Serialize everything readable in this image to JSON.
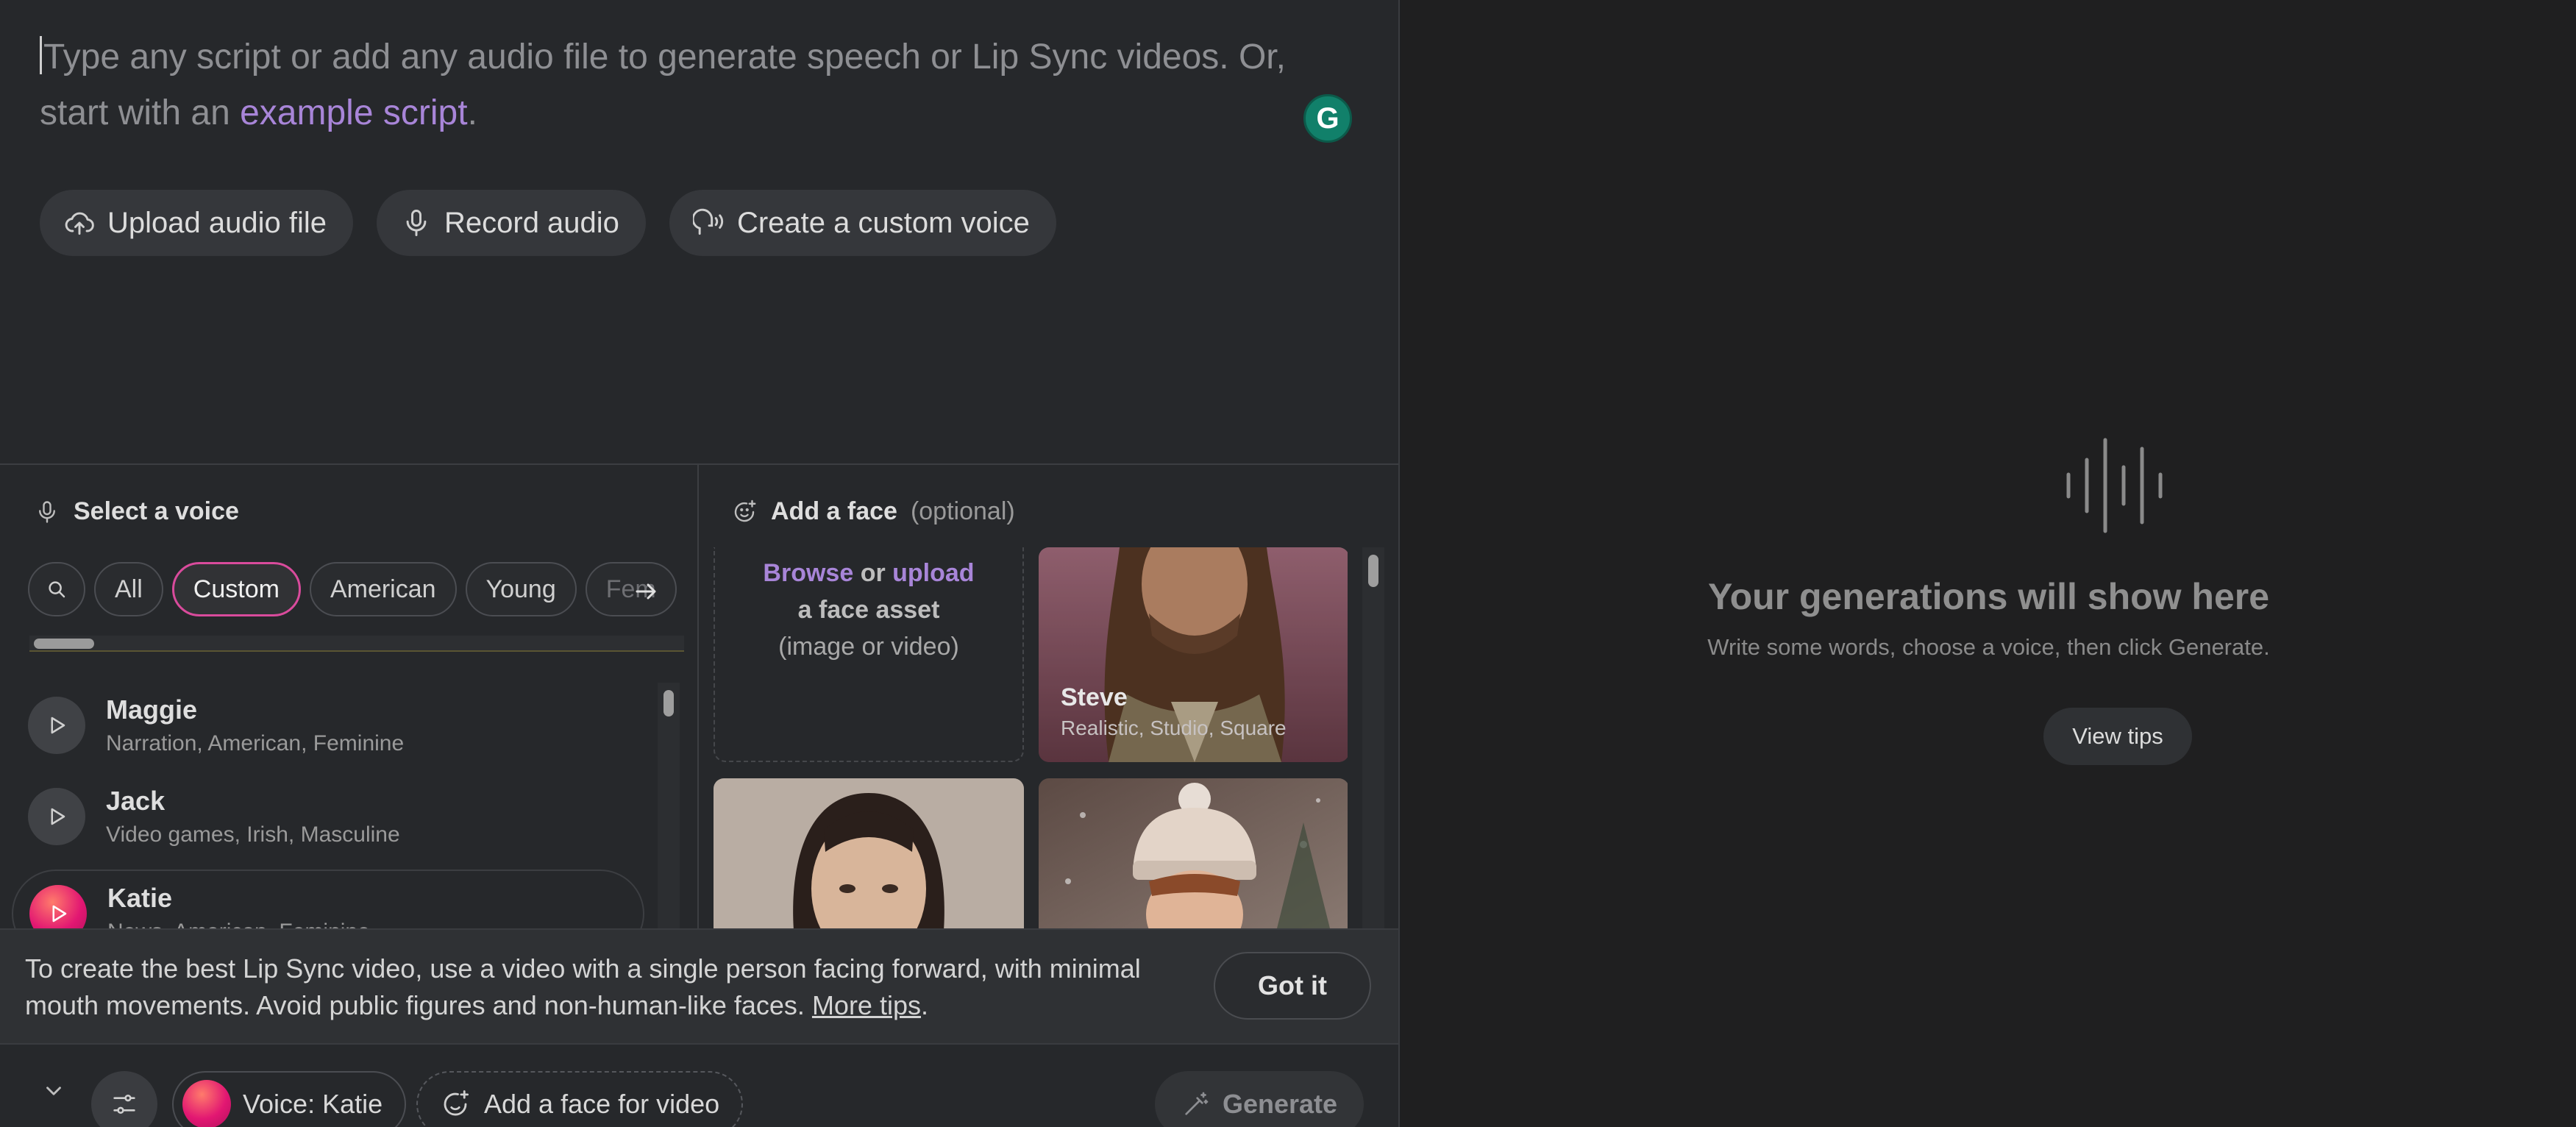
{
  "script": {
    "placeholder_before": "Type any script or add any audio file to generate speech or Lip Sync videos. Or, start with an ",
    "example_link": "example script",
    "placeholder_after": ".",
    "grammarly_letter": "G"
  },
  "actions": {
    "upload": "Upload audio file",
    "record": "Record audio",
    "custom_voice": "Create a custom voice"
  },
  "voice_panel": {
    "title": "Select a voice",
    "filters": [
      "All",
      "Custom",
      "American",
      "Young",
      "Fem"
    ],
    "active_filter": "Custom",
    "voices": [
      {
        "name": "Maggie",
        "tags": "Narration, American, Feminine"
      },
      {
        "name": "Jack",
        "tags": "Video games, Irish, Masculine"
      },
      {
        "name": "Katie",
        "tags": "News, American, Feminine"
      }
    ]
  },
  "face_panel": {
    "title": "Add a face",
    "title_optional": "(optional)",
    "upload": {
      "browse": "Browse",
      "or": "or",
      "upload": "upload",
      "line2": "a face asset",
      "line3": "(image or video)"
    },
    "faces": [
      {
        "name": "Steve",
        "desc": "Realistic, Studio, Square"
      }
    ]
  },
  "tip": {
    "text": "To create the best Lip Sync video, use a video with a single person facing forward, with minimal mouth movements. Avoid public figures and non-human-like faces.",
    "link": "More tips",
    "after": ".",
    "button": "Got it"
  },
  "bottom": {
    "voice_label": "Voice: Katie",
    "face_label": "Add a face for video",
    "generate": "Generate"
  },
  "empty_state": {
    "title": "Your generations will show here",
    "subtitle": "Write some words, choose a voice, then click Generate.",
    "button": "View tips"
  },
  "colors": {
    "accent_purple": "#a885d8",
    "active_chip_border": "#d94b9c",
    "grammarly": "#11806a"
  }
}
